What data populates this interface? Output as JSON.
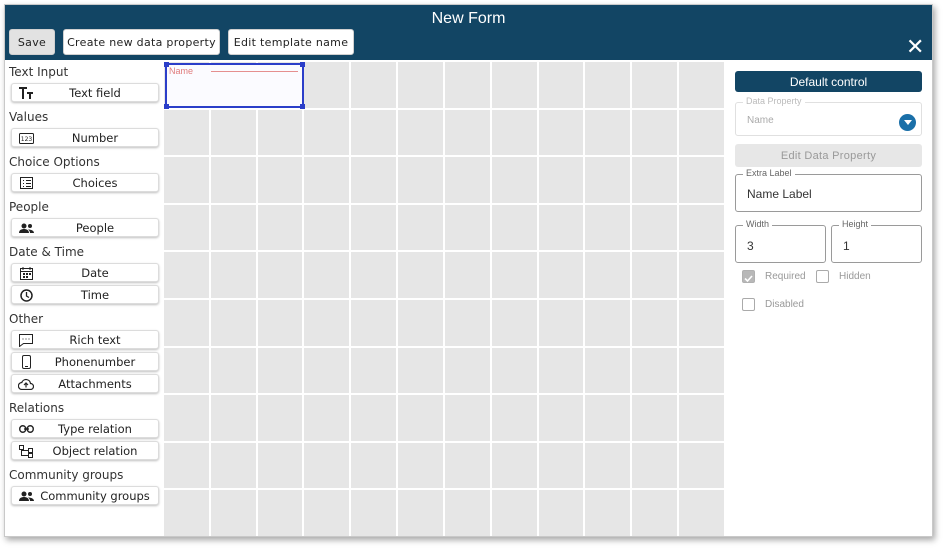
{
  "header": {
    "title": "New Form",
    "save_label": "Save",
    "create_label": "Create new data property",
    "edit_name_label": "Edit template name"
  },
  "palette": {
    "sections": [
      {
        "title": "Text Input",
        "items": [
          {
            "label": "Text field",
            "icon": "text-format-icon"
          }
        ]
      },
      {
        "title": "Values",
        "items": [
          {
            "label": "Number",
            "icon": "number-icon"
          }
        ]
      },
      {
        "title": "Choice Options",
        "items": [
          {
            "label": "Choices",
            "icon": "list-icon"
          }
        ]
      },
      {
        "title": "People",
        "items": [
          {
            "label": "People",
            "icon": "people-icon"
          }
        ]
      },
      {
        "title": "Date & Time",
        "items": [
          {
            "label": "Date",
            "icon": "calendar-icon"
          },
          {
            "label": "Time",
            "icon": "clock-icon"
          }
        ]
      },
      {
        "title": "Other",
        "items": [
          {
            "label": "Rich text",
            "icon": "comment-icon"
          },
          {
            "label": "Phonenumber",
            "icon": "phone-icon"
          },
          {
            "label": "Attachments",
            "icon": "cloud-upload-icon"
          }
        ]
      },
      {
        "title": "Relations",
        "items": [
          {
            "label": "Type relation",
            "icon": "link-icon"
          },
          {
            "label": "Object relation",
            "icon": "hierarchy-icon"
          }
        ]
      },
      {
        "title": "Community groups",
        "items": [
          {
            "label": "Community groups",
            "icon": "people-icon"
          }
        ]
      }
    ]
  },
  "canvas": {
    "columns": 12,
    "rows": 10,
    "placed_control": {
      "label": "Name"
    }
  },
  "panel": {
    "default_control_label": "Default control",
    "data_property": {
      "label": "Data Property",
      "value": "Name"
    },
    "edit_data_property_label": "Edit Data Property",
    "extra_label": {
      "label": "Extra Label",
      "value": "Name Label"
    },
    "width": {
      "label": "Width",
      "value": "3"
    },
    "height": {
      "label": "Height",
      "value": "1"
    },
    "required": {
      "label": "Required",
      "checked": true
    },
    "hidden": {
      "label": "Hidden",
      "checked": false
    },
    "disabled": {
      "label": "Disabled",
      "checked": false
    }
  },
  "colors": {
    "header_bg": "#124564",
    "selection": "#2b3ec9",
    "grid_cell": "#e6e6e6",
    "dropdown_accent": "#1a6fa8"
  }
}
